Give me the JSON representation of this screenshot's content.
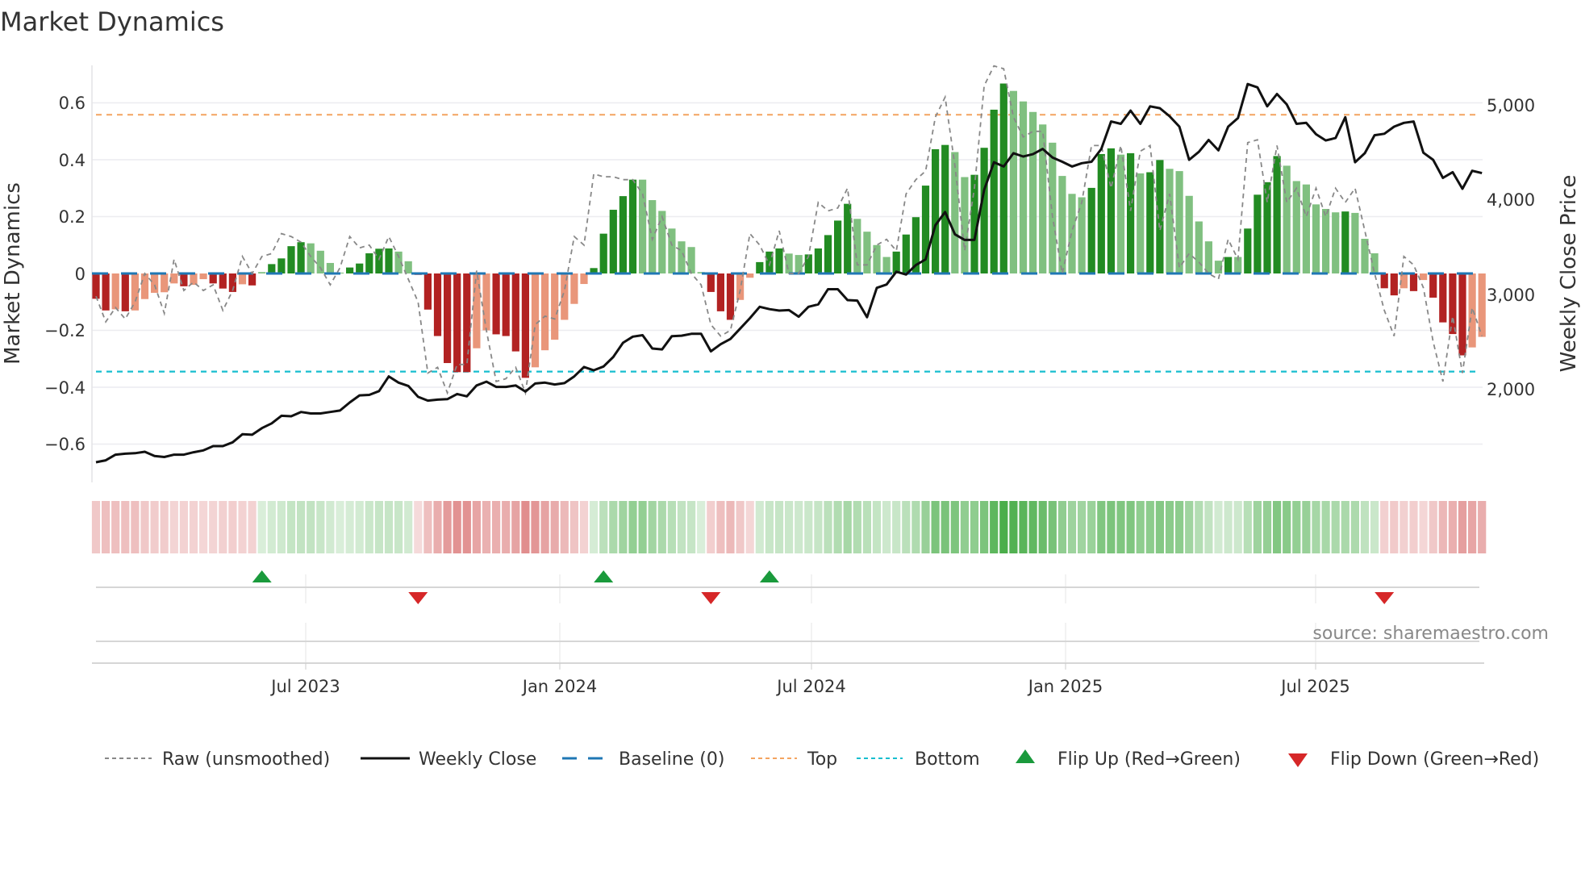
{
  "title": "Market Dynamics",
  "source": "source: sharemaestro.com",
  "legend": {
    "raw": "Raw (unsmoothed)",
    "close": "Weekly Close",
    "baseline": "Baseline (0)",
    "top": "Top",
    "bottom": "Bottom",
    "flip_up": "Flip Up (Red→Green)",
    "flip_down": "Flip Down (Green→Red)"
  },
  "colors": {
    "pos_strong": "#228b22",
    "pos_weak": "#80c080",
    "neg_strong": "#b22222",
    "neg_weak": "#e9967a",
    "close": "#111111",
    "raw": "#888888",
    "baseline": "#1f77b4",
    "top": "#f4a460",
    "bottom": "#17becf",
    "flip_up": "#1a9a3c",
    "flip_down": "#d62728"
  },
  "chart_data": {
    "type": "bar",
    "title": "Market Dynamics",
    "ylabel": "Market Dynamics",
    "y2label": "Weekly Close Price",
    "ylim": [
      -0.73,
      0.73
    ],
    "y2lim": [
      1017,
      5417
    ],
    "yticks": [
      "0.6",
      "0.4",
      "0.2",
      "0",
      "−0.2",
      "−0.4",
      "−0.6"
    ],
    "y2ticks": [
      "5,000",
      "4,000",
      "3,000",
      "2,000"
    ],
    "xticks": [
      "Jul 2023",
      "Jan 2024",
      "Jul 2024",
      "Jan 2025",
      "Jul 2025"
    ],
    "frequency": "weekly",
    "top_threshold": 0.558,
    "bottom_threshold": -0.345,
    "baseline": 0,
    "values": [
      -0.089,
      -0.13,
      -0.126,
      -0.133,
      -0.13,
      -0.09,
      -0.068,
      -0.066,
      -0.035,
      -0.045,
      -0.04,
      -0.02,
      -0.035,
      -0.053,
      -0.065,
      -0.038,
      -0.042,
      0.005,
      0.033,
      0.053,
      0.096,
      0.11,
      0.106,
      0.08,
      0.037,
      0.003,
      0.021,
      0.035,
      0.071,
      0.087,
      0.088,
      0.077,
      0.043,
      -0.005,
      -0.127,
      -0.22,
      -0.315,
      -0.347,
      -0.347,
      -0.263,
      -0.2,
      -0.214,
      -0.22,
      -0.274,
      -0.367,
      -0.33,
      -0.27,
      -0.233,
      -0.163,
      -0.107,
      -0.037,
      0.019,
      0.14,
      0.224,
      0.272,
      0.33,
      0.33,
      0.258,
      0.22,
      0.158,
      0.113,
      0.093,
      0.005,
      -0.065,
      -0.133,
      -0.163,
      -0.093,
      -0.015,
      0.04,
      0.077,
      0.088,
      0.07,
      0.065,
      0.067,
      0.088,
      0.135,
      0.186,
      0.245,
      0.192,
      0.147,
      0.1,
      0.058,
      0.077,
      0.137,
      0.198,
      0.309,
      0.437,
      0.452,
      0.427,
      0.339,
      0.347,
      0.442,
      0.576,
      0.668,
      0.642,
      0.605,
      0.568,
      0.524,
      0.46,
      0.343,
      0.28,
      0.268,
      0.301,
      0.42,
      0.44,
      0.418,
      0.423,
      0.352,
      0.356,
      0.399,
      0.368,
      0.36,
      0.273,
      0.183,
      0.113,
      0.045,
      0.058,
      0.058,
      0.158,
      0.277,
      0.321,
      0.413,
      0.379,
      0.325,
      0.313,
      0.243,
      0.227,
      0.215,
      0.218,
      0.213,
      0.122,
      0.071,
      -0.052,
      -0.077,
      -0.052,
      -0.062,
      -0.023,
      -0.085,
      -0.172,
      -0.213,
      -0.288,
      -0.26,
      -0.223
    ],
    "strengthening": [
      1,
      1,
      0,
      1,
      0,
      0,
      0,
      0,
      0,
      1,
      0,
      0,
      1,
      1,
      1,
      0,
      1,
      0,
      1,
      1,
      1,
      1,
      0,
      0,
      0,
      0,
      1,
      1,
      1,
      1,
      1,
      0,
      0,
      1,
      1,
      1,
      1,
      1,
      1,
      0,
      0,
      1,
      1,
      1,
      1,
      0,
      0,
      0,
      0,
      0,
      0,
      1,
      1,
      1,
      1,
      1,
      0,
      0,
      0,
      0,
      0,
      0,
      0,
      1,
      1,
      1,
      0,
      0,
      1,
      1,
      1,
      0,
      0,
      1,
      1,
      1,
      1,
      1,
      0,
      0,
      0,
      0,
      1,
      1,
      1,
      1,
      1,
      1,
      0,
      0,
      1,
      1,
      1,
      1,
      0,
      0,
      0,
      0,
      0,
      0,
      0,
      0,
      1,
      1,
      1,
      0,
      1,
      0,
      1,
      1,
      0,
      0,
      0,
      0,
      0,
      0,
      1,
      0,
      1,
      1,
      1,
      1,
      0,
      0,
      0,
      0,
      0,
      0,
      1,
      0,
      0,
      0,
      1,
      1,
      0,
      1,
      0,
      1,
      1,
      1,
      1,
      0,
      0
    ],
    "raw": [
      -0.08,
      -0.17,
      -0.12,
      -0.16,
      -0.1,
      0.0,
      -0.04,
      -0.14,
      0.05,
      -0.06,
      -0.03,
      -0.06,
      -0.04,
      -0.13,
      -0.06,
      0.06,
      0.0,
      0.06,
      0.07,
      0.14,
      0.13,
      0.11,
      0.06,
      0.02,
      -0.04,
      0.02,
      0.13,
      0.09,
      0.1,
      0.05,
      0.13,
      0.06,
      -0.02,
      -0.1,
      -0.35,
      -0.33,
      -0.42,
      -0.32,
      -0.32,
      0.01,
      -0.2,
      -0.38,
      -0.37,
      -0.33,
      -0.42,
      -0.18,
      -0.15,
      -0.16,
      -0.06,
      0.13,
      0.1,
      0.35,
      0.34,
      0.34,
      0.33,
      0.33,
      0.28,
      0.12,
      0.2,
      0.1,
      0.08,
      0.0,
      -0.04,
      -0.18,
      -0.22,
      -0.2,
      -0.06,
      0.14,
      0.1,
      0.03,
      0.15,
      0.0,
      0.0,
      0.06,
      0.25,
      0.22,
      0.23,
      0.3,
      0.03,
      0.03,
      0.1,
      0.12,
      0.08,
      0.28,
      0.33,
      0.36,
      0.55,
      0.62,
      0.38,
      0.08,
      0.3,
      0.66,
      0.73,
      0.72,
      0.55,
      0.48,
      0.5,
      0.5,
      0.2,
      0.0,
      0.15,
      0.25,
      0.45,
      0.45,
      0.3,
      0.45,
      0.22,
      0.43,
      0.45,
      0.15,
      0.28,
      0.02,
      0.07,
      0.04,
      0.0,
      -0.02,
      0.12,
      0.05,
      0.46,
      0.47,
      0.25,
      0.45,
      0.25,
      0.3,
      0.2,
      0.3,
      0.2,
      0.3,
      0.25,
      0.3,
      0.15,
      0.0,
      -0.13,
      -0.22,
      0.06,
      0.03,
      -0.05,
      -0.24,
      -0.38,
      -0.15,
      -0.35,
      -0.12,
      -0.22
    ],
    "close": [
      1230,
      1250,
      1310,
      1320,
      1325,
      1340,
      1295,
      1285,
      1310,
      1310,
      1335,
      1355,
      1400,
      1400,
      1440,
      1525,
      1520,
      1590,
      1640,
      1720,
      1715,
      1760,
      1745,
      1745,
      1760,
      1775,
      1860,
      1935,
      1940,
      1980,
      2135,
      2070,
      2035,
      1920,
      1880,
      1890,
      1895,
      1950,
      1925,
      2040,
      2080,
      2025,
      2025,
      2040,
      1975,
      2060,
      2070,
      2050,
      2065,
      2135,
      2235,
      2200,
      2240,
      2340,
      2490,
      2555,
      2570,
      2430,
      2420,
      2560,
      2565,
      2585,
      2585,
      2400,
      2475,
      2530,
      2640,
      2750,
      2870,
      2845,
      2830,
      2835,
      2765,
      2870,
      2895,
      3055,
      3055,
      2940,
      2935,
      2760,
      3070,
      3105,
      3240,
      3210,
      3310,
      3370,
      3730,
      3870,
      3635,
      3575,
      3575,
      4105,
      4395,
      4350,
      4490,
      4455,
      4480,
      4535,
      4445,
      4400,
      4350,
      4385,
      4400,
      4535,
      4825,
      4800,
      4940,
      4800,
      4985,
      4965,
      4880,
      4770,
      4420,
      4505,
      4630,
      4520,
      4770,
      4860,
      5220,
      5185,
      4985,
      5115,
      5005,
      4800,
      4810,
      4690,
      4625,
      4650,
      4870,
      4395,
      4490,
      4680,
      4695,
      4770,
      4810,
      4825,
      4495,
      4420,
      4230,
      4290,
      4115,
      4305,
      4280
    ],
    "flip_up_weeks": [
      17,
      52,
      69
    ],
    "flip_down_weeks": [
      33,
      63,
      132
    ]
  }
}
